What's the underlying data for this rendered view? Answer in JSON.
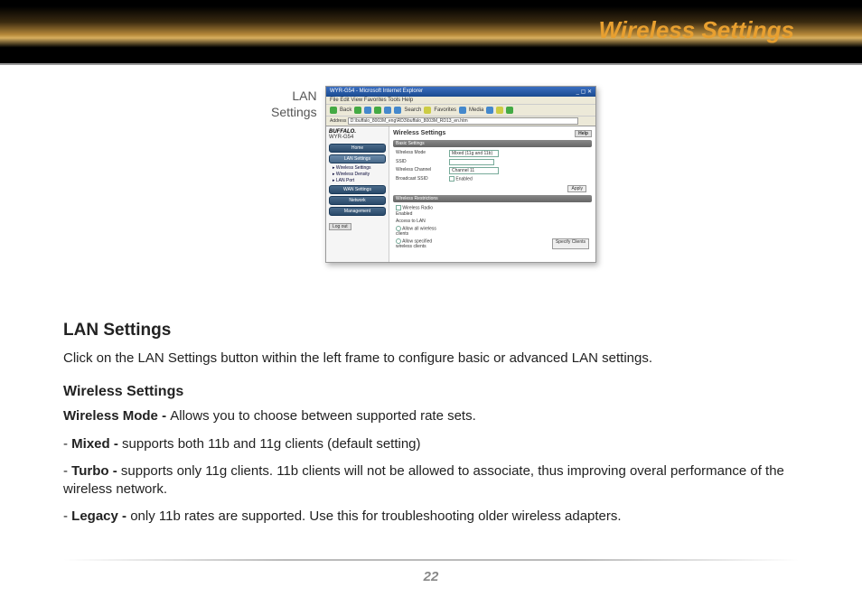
{
  "header": {
    "title": "Wireless Settings"
  },
  "figure": {
    "side_label_line1": "LAN",
    "side_label_line2": "Settings",
    "titlebar": "WYR-G54 - Microsoft Internet Explorer",
    "menubar": "File  Edit  View  Favorites  Tools  Help",
    "toolbar_back": "Back",
    "toolbar_search": "Search",
    "toolbar_favorites": "Favorites",
    "toolbar_media": "Media",
    "address_label": "Address",
    "address_value": "D:\\buffalo_8003M_eng\\RD3\\buffalo_8003M_RD13_en.htm",
    "logo": "BUFFALO.",
    "device": "WYR-G54",
    "nav_home": "Home",
    "nav_lan": "LAN Settings",
    "sub_wireless": "▸ Wireless Settings",
    "sub_density": "▸ Wireless Density",
    "sub_lanport": "▸ LAN Port",
    "nav_wan": "WAN Settings",
    "nav_network": "Network",
    "nav_mgmt": "Management",
    "logout": "Log out",
    "main_title": "Wireless Settings",
    "help": "Help",
    "section_basic": "Basic Settings",
    "row_mode_label": "Wireless Mode",
    "row_mode_value": "Mixed (11g and 11b)",
    "row_ssid_label": "SSID",
    "row_channel_label": "Wireless Channel",
    "row_channel_value": "Channel 11",
    "row_broadcast_label": "Broadcast SSID",
    "row_broadcast_value": "Enabled",
    "apply": "Apply",
    "section_restrict": "Wireless Restrictions",
    "restrict_radio_enabled": "Wireless Radio Enabled",
    "access_title": "Access to LAN",
    "access_allow_all": "Allow all wireless clients",
    "access_allow_spec": "Allow specified wireless clients",
    "specify": "Specify Clients"
  },
  "doc": {
    "h1": "LAN Settings",
    "p1": "Click on the LAN Settings button within the left frame to configure basic or advanced LAN settings.",
    "h2": "Wireless Settings",
    "mode_label": "Wireless Mode - ",
    "mode_text": "Allows you to choose between supported rate sets.",
    "mixed_label": "Mixed - ",
    "mixed_text": "supports both 11b and 11g clients (default setting)",
    "turbo_label": "Turbo - ",
    "turbo_text": "supports only 11g clients. 11b clients will not be allowed to associate, thus improving overal performance of the wireless network.",
    "legacy_label": "Legacy - ",
    "legacy_text": "only 11b rates are supported. Use this for troubleshooting older wireless adapters."
  },
  "page_number": "22"
}
